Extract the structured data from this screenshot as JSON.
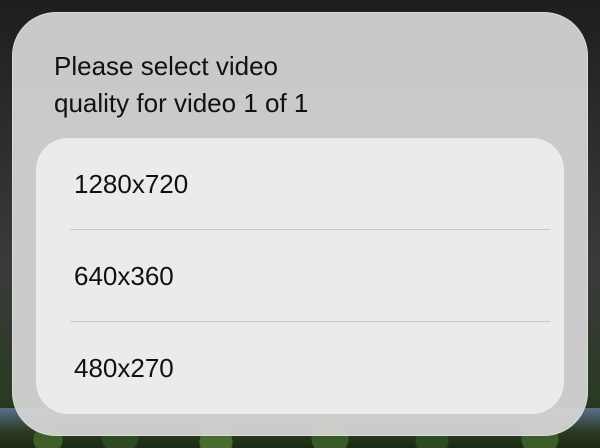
{
  "dialog": {
    "title": "Please select video quality for video 1 of 1",
    "options": [
      {
        "label": "1280x720"
      },
      {
        "label": "640x360"
      },
      {
        "label": "480x270"
      }
    ]
  },
  "colors": {
    "sheet_background": "#d6d6d6",
    "options_background": "#eeeeee",
    "divider": "#c6c6c6",
    "text": "#111111"
  }
}
